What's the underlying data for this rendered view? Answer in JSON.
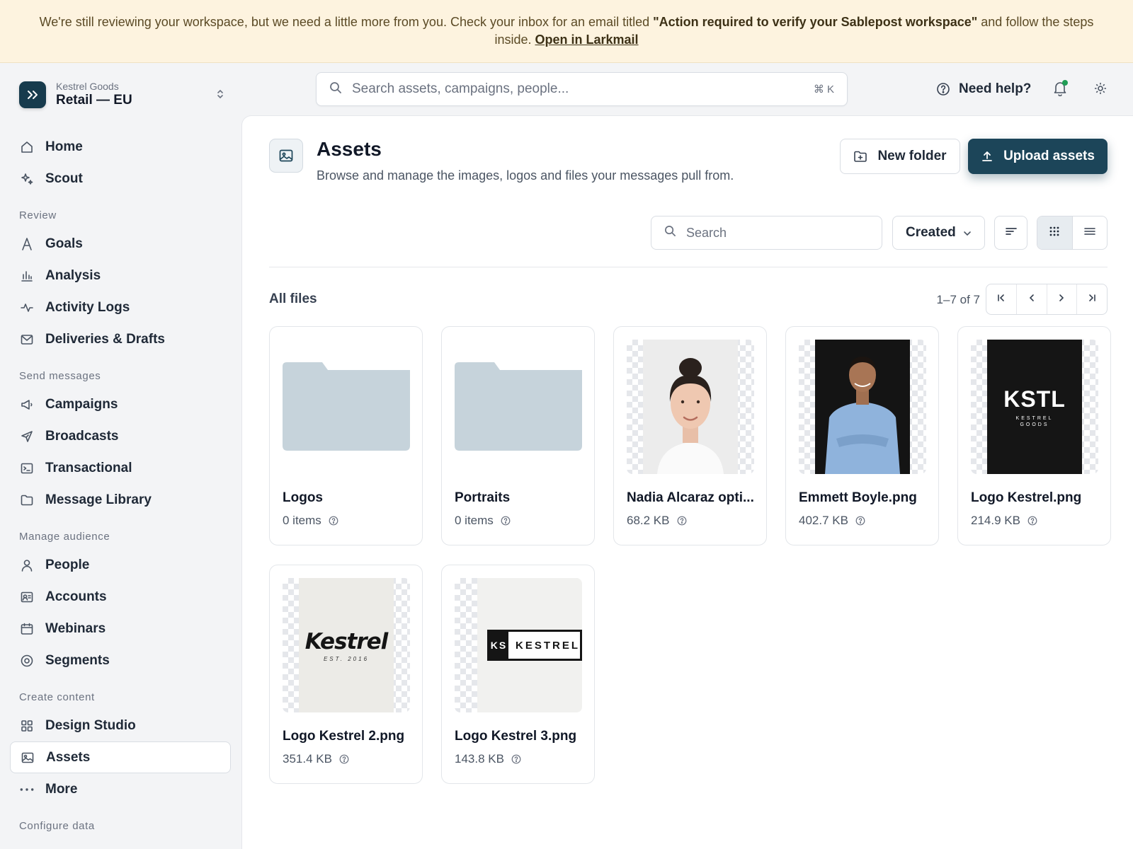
{
  "banner": {
    "text_before": "We're still reviewing your workspace, but we need a little more from you. Check your inbox for an email titled ",
    "email_title": "\"Action required to verify your Sablepost workspace\"",
    "text_after": " and follow the steps inside. ",
    "link": "Open in Larkmail"
  },
  "workspace": {
    "org": "Kestrel Goods",
    "name": "Retail — EU"
  },
  "sidebar": {
    "top": [
      {
        "label": "Home",
        "icon": "home-icon"
      },
      {
        "label": "Scout",
        "icon": "sparkle-icon"
      }
    ],
    "sections": [
      {
        "title": "Review",
        "items": [
          {
            "label": "Goals",
            "icon": "goal-icon"
          },
          {
            "label": "Analysis",
            "icon": "bar-chart-icon"
          },
          {
            "label": "Activity Logs",
            "icon": "activity-icon"
          },
          {
            "label": "Deliveries & Drafts",
            "icon": "mail-icon"
          }
        ]
      },
      {
        "title": "Send messages",
        "items": [
          {
            "label": "Campaigns",
            "icon": "megaphone-icon"
          },
          {
            "label": "Broadcasts",
            "icon": "send-icon"
          },
          {
            "label": "Transactional",
            "icon": "terminal-icon"
          },
          {
            "label": "Message Library",
            "icon": "folder-icon"
          }
        ]
      },
      {
        "title": "Manage audience",
        "items": [
          {
            "label": "People",
            "icon": "person-icon"
          },
          {
            "label": "Accounts",
            "icon": "id-card-icon"
          },
          {
            "label": "Webinars",
            "icon": "calendar-icon"
          },
          {
            "label": "Segments",
            "icon": "target-icon"
          }
        ]
      },
      {
        "title": "Create content",
        "items": [
          {
            "label": "Design Studio",
            "icon": "grid-icon"
          },
          {
            "label": "Assets",
            "icon": "image-icon",
            "active": true
          },
          {
            "label": "More",
            "icon": "more-icon"
          }
        ]
      },
      {
        "title": "Configure data",
        "items": []
      }
    ]
  },
  "topbar": {
    "search_placeholder": "Search assets, campaigns, people...",
    "shortcut": "⌘ K",
    "help_label": "Need help?"
  },
  "page": {
    "title": "Assets",
    "subtitle": "Browse and manage the images, logos and files your messages pull from.",
    "new_folder_label": "New folder",
    "upload_label": "Upload assets",
    "filter_placeholder": "Search",
    "sort_value": "Created",
    "section_title": "All files",
    "range": "1–7 of 7"
  },
  "files": [
    {
      "name": "Logos",
      "meta": "0 items",
      "kind": "folder"
    },
    {
      "name": "Portraits",
      "meta": "0 items",
      "kind": "folder"
    },
    {
      "name": "Nadia Alcaraz opti...",
      "meta": "68.2 KB",
      "kind": "portrait-woman"
    },
    {
      "name": "Emmett Boyle.png",
      "meta": "402.7 KB",
      "kind": "portrait-man"
    },
    {
      "name": "Logo Kestrel.png",
      "meta": "214.9 KB",
      "kind": "logo-dark"
    },
    {
      "name": "Logo Kestrel 2.png",
      "meta": "351.4 KB",
      "kind": "logo-script"
    },
    {
      "name": "Logo Kestrel 3.png",
      "meta": "143.8 KB",
      "kind": "logo-bar"
    }
  ],
  "logo_text": {
    "kstl": "KSTL",
    "kestrel_goods": "KESTREL GOODS",
    "kestrel_script": "Kestrel",
    "est": "EST. 2016",
    "ks": "KS",
    "kestrel_caps": "KESTREL"
  },
  "colors": {
    "accent": "#1c4559",
    "banner_bg": "#fdf3df",
    "folder": "#c6d3db"
  }
}
